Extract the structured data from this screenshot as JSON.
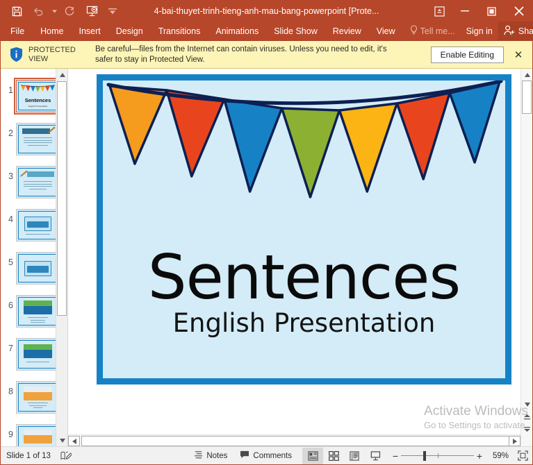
{
  "window": {
    "title": "4-bai-thuyet-trinh-tieng-anh-mau-bang-powerpoint [Prote...",
    "quick_access": [
      {
        "name": "save",
        "label": "Save"
      },
      {
        "name": "undo",
        "label": "Undo"
      },
      {
        "name": "redo",
        "label": "Redo"
      },
      {
        "name": "start-from-beginning",
        "label": "Start From Beginning"
      },
      {
        "name": "customize-quick-access-toolbar",
        "label": "Customize Quick Access Toolbar"
      }
    ],
    "controls": [
      {
        "name": "ribbon-display-options",
        "label": "Ribbon Display Options"
      },
      {
        "name": "minimize",
        "label": "Minimize"
      },
      {
        "name": "restore",
        "label": "Restore Down"
      },
      {
        "name": "close",
        "label": "Close"
      }
    ],
    "accent_color": "#b7472a"
  },
  "ribbon": {
    "tabs": [
      {
        "label": "File"
      },
      {
        "label": "Home"
      },
      {
        "label": "Insert"
      },
      {
        "label": "Design"
      },
      {
        "label": "Transitions"
      },
      {
        "label": "Animations"
      },
      {
        "label": "Slide Show"
      },
      {
        "label": "Review"
      },
      {
        "label": "View"
      }
    ],
    "tell_me": "Tell me...",
    "sign_in": "Sign in",
    "share": "Share"
  },
  "protected_view": {
    "label_line1": "PROTECTED",
    "label_line2": "VIEW",
    "message_line1": "Be careful—files from the Internet can contain viruses. Unless you need to edit, it's",
    "message_line2": "safer to stay in Protected View.",
    "enable_button": "Enable Editing",
    "close": "✕",
    "background": "#fdf4b8"
  },
  "thumbnails": [
    {
      "number": "1",
      "kind": "title",
      "selected": true,
      "title": "Sentences",
      "subtitle": "English Presentation"
    },
    {
      "number": "2",
      "kind": "banner-text",
      "selected": false,
      "banner": "What is a sentence?",
      "lines": 4
    },
    {
      "number": "3",
      "kind": "banner-text",
      "selected": false,
      "banner": "Quiz Time!",
      "lines": 4
    },
    {
      "number": "4",
      "kind": "picture-light",
      "selected": false,
      "lines": 1
    },
    {
      "number": "5",
      "kind": "picture-light",
      "selected": false,
      "lines": 0
    },
    {
      "number": "6",
      "kind": "picture-beach",
      "selected": false,
      "lines": 3
    },
    {
      "number": "7",
      "kind": "picture-beach",
      "selected": false,
      "lines": 1
    },
    {
      "number": "8",
      "kind": "picture-desert",
      "selected": false,
      "lines": 3
    },
    {
      "number": "9",
      "kind": "picture-desert",
      "selected": false,
      "lines": 1
    }
  ],
  "slide": {
    "title": "Sentences",
    "subtitle": "English Presentation",
    "background": "#d3ecf7",
    "frame_color": "#1682c5",
    "bunting_colors": [
      "#f59b1e",
      "#e8451e",
      "#1682c5",
      "#8cb032",
      "#fcb415",
      "#e8451e",
      "#1682c5"
    ],
    "string_color": "#0e1f52"
  },
  "watermark": {
    "line1": "Activate Windows",
    "line2": "Go to Settings to activate"
  },
  "status_bar": {
    "slide_count": "Slide 1 of 13",
    "notes_label": "Notes",
    "comments_label": "Comments",
    "views": [
      {
        "name": "normal-view",
        "label": "Normal",
        "active": true
      },
      {
        "name": "slide-sorter-view",
        "label": "Slide Sorter",
        "active": false
      },
      {
        "name": "reading-view",
        "label": "Reading View",
        "active": false
      },
      {
        "name": "slide-show-view",
        "label": "Slide Show",
        "active": false
      }
    ],
    "zoom_out": "−",
    "zoom_in": "+",
    "zoom_level": "59%",
    "fit_label": "Fit slide to current window"
  }
}
